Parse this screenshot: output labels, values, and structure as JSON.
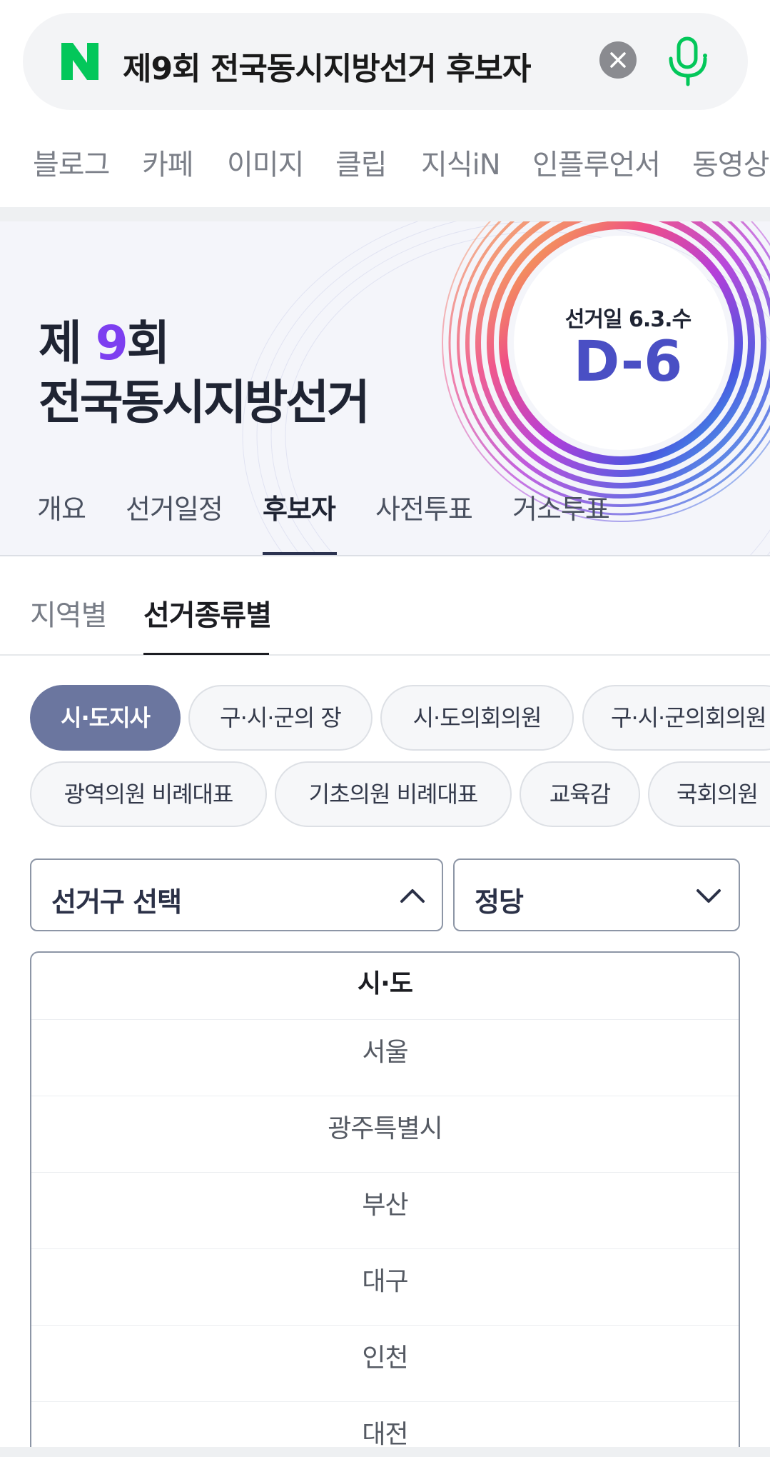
{
  "search": {
    "query": "제9회 전국동시지방선거 후보자",
    "logo_icon": "naver-n-logo-icon",
    "brand_color": "#03c75a"
  },
  "categories": [
    "블로그",
    "카페",
    "이미지",
    "클립",
    "지식iN",
    "인플루언서",
    "동영상"
  ],
  "banner": {
    "title_part1": "제 ",
    "title_number": "9",
    "title_part2": "회",
    "title_line2": "전국동시지방선거",
    "election_day": "선거일 6.3.수",
    "dday": "D-6",
    "tabs": [
      "개요",
      "선거일정",
      "후보자",
      "사전투표",
      "거소투표"
    ],
    "active_tab": "후보자"
  },
  "sub_tabs": [
    "지역별",
    "선거종류별"
  ],
  "active_sub_tab": "선거종류별",
  "chips_row1": [
    "시·도지사",
    "구·시·군의 장",
    "시·도의회의원",
    "구·시·군의회의원"
  ],
  "chips_row2": [
    "광역의원 비례대표",
    "기초의원 비례대표",
    "교육감",
    "국회의원"
  ],
  "active_chip": "시·도지사",
  "selects": {
    "district": "선거구 선택",
    "party": "정당"
  },
  "dropdown": {
    "header": "시·도",
    "options": [
      "서울",
      "광주특별시",
      "부산",
      "대구",
      "인천",
      "대전"
    ]
  }
}
